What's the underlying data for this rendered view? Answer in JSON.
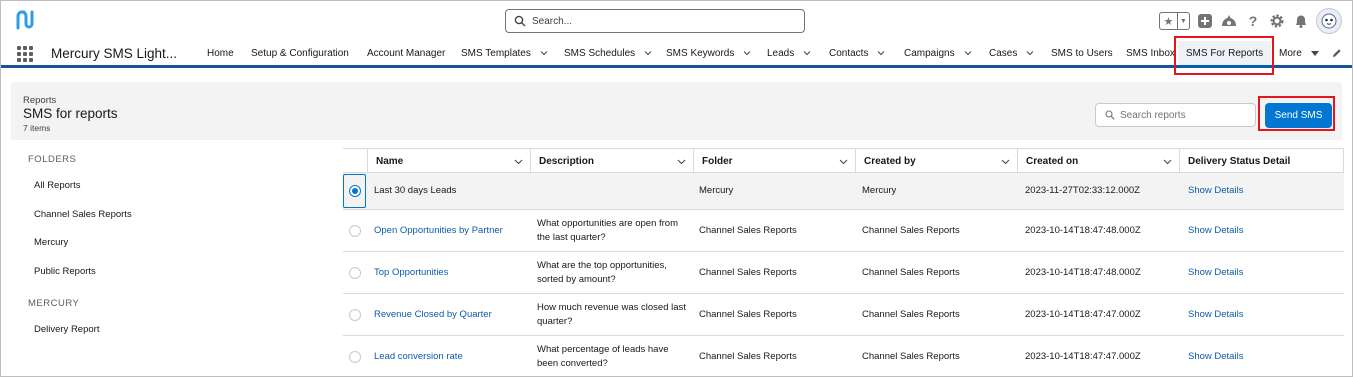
{
  "header": {
    "search_placeholder": "Search..."
  },
  "nav": {
    "app_name": "Mercury SMS Light...",
    "items": [
      {
        "label": "Home"
      },
      {
        "label": "Setup & Configuration"
      },
      {
        "label": "Account Manager"
      },
      {
        "label": "SMS Templates"
      },
      {
        "label": "SMS Schedules"
      },
      {
        "label": "SMS Keywords"
      },
      {
        "label": "Leads"
      },
      {
        "label": "Contacts"
      },
      {
        "label": "Campaigns"
      },
      {
        "label": "Cases"
      },
      {
        "label": "SMS to Users"
      },
      {
        "label": "SMS Inbox"
      },
      {
        "label": "SMS For Reports"
      }
    ],
    "more_label": "More",
    "active_item": "SMS For Reports"
  },
  "page": {
    "breadcrumb": "Reports",
    "title": "SMS for reports",
    "item_count": "7 items",
    "search_placeholder": "Search reports",
    "send_button": "Send SMS"
  },
  "sidebar": {
    "folders_heading": "FOLDERS",
    "folders": [
      {
        "label": "All Reports"
      },
      {
        "label": "Channel Sales Reports"
      },
      {
        "label": "Mercury"
      },
      {
        "label": "Public Reports"
      }
    ],
    "mercury_heading": "MERCURY",
    "mercury_items": [
      {
        "label": "Delivery Report"
      }
    ]
  },
  "table": {
    "columns": [
      "Name",
      "Description",
      "Folder",
      "Created by",
      "Created on",
      "Delivery Status Detail"
    ],
    "rows": [
      {
        "name": "Last 30 days Leads",
        "description_1": "",
        "description_2": "",
        "folder": "Mercury",
        "created_by": "Mercury",
        "created_on": "2023-11-27T02:33:12.000Z",
        "detail": "Show Details",
        "selected": true
      },
      {
        "name": "Open Opportunities by Partner",
        "description_1": "What opportunities are open from",
        "description_2": "the last quarter?",
        "folder": "Channel Sales Reports",
        "created_by": "Channel Sales Reports",
        "created_on": "2023-10-14T18:47:48.000Z",
        "detail": "Show Details",
        "selected": false
      },
      {
        "name": "Top Opportunities",
        "description_1": "What are the top opportunities,",
        "description_2": "sorted by amount?",
        "folder": "Channel Sales Reports",
        "created_by": "Channel Sales Reports",
        "created_on": "2023-10-14T18:47:48.000Z",
        "detail": "Show Details",
        "selected": false
      },
      {
        "name": "Revenue Closed by Quarter",
        "description_1": "How much revenue was closed last",
        "description_2": "quarter?",
        "folder": "Channel Sales Reports",
        "created_by": "Channel Sales Reports",
        "created_on": "2023-10-14T18:47:47.000Z",
        "detail": "Show Details",
        "selected": false
      },
      {
        "name": "Lead conversion rate",
        "description_1": "What percentage of leads have",
        "description_2": "been converted?",
        "folder": "Channel Sales Reports",
        "created_by": "Channel Sales Reports",
        "created_on": "2023-10-14T18:47:47.000Z",
        "detail": "Show Details",
        "selected": false
      }
    ]
  },
  "colors": {
    "brand": "#0176d3",
    "nav_underline": "#1b5297",
    "link": "#0b5cab",
    "highlight_box": "#e4161b"
  }
}
